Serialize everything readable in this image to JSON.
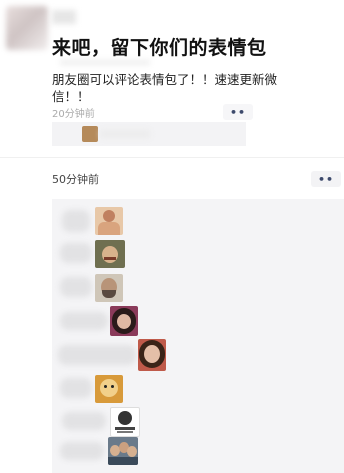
{
  "post": {
    "title": "来吧，留下你们的表情包",
    "body": "朋友圈可以评论表情包了！！速速更新微信！！",
    "time": "20分钟前",
    "more_glyph": "••"
  },
  "second_post": {
    "time": "50分钟前",
    "more_glyph": "••"
  },
  "comments": [
    {
      "sticker": "shirtless-man-sticker"
    },
    {
      "sticker": "smiling-man-sticker"
    },
    {
      "sticker": "bearded-man-sticker"
    },
    {
      "sticker": "woman-sticker"
    },
    {
      "sticker": "woman-closeup-sticker"
    },
    {
      "sticker": "cartoon-face-sticker"
    },
    {
      "sticker": "meme-text-sticker"
    },
    {
      "sticker": "group-photo-sticker"
    }
  ]
}
